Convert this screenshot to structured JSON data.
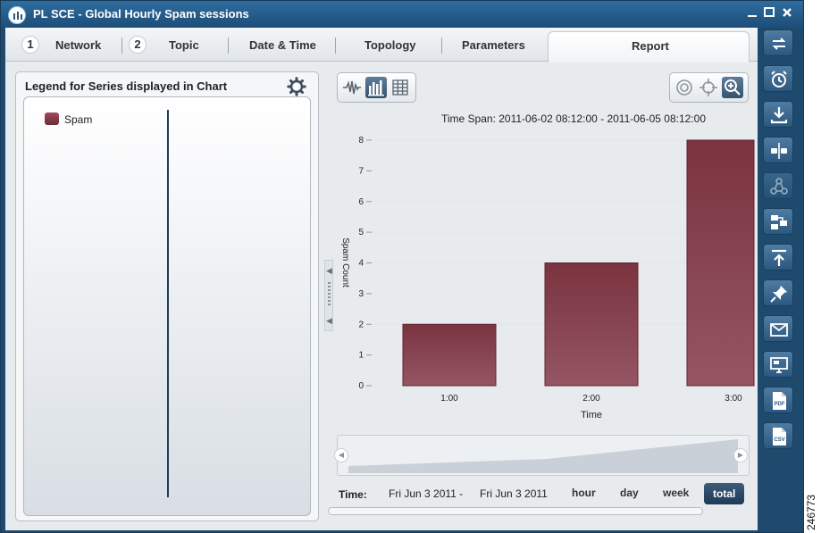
{
  "window": {
    "title": "PL SCE - Global Hourly Spam sessions",
    "controls": [
      "minimize",
      "maximize",
      "close"
    ]
  },
  "tabs": [
    {
      "num": "1",
      "label": "Network"
    },
    {
      "num": "2",
      "label": "Topic"
    },
    {
      "num": "",
      "label": "Date & Time"
    },
    {
      "num": "",
      "label": "Topology"
    },
    {
      "num": "",
      "label": "Parameters"
    },
    {
      "num": "",
      "label": "Report",
      "active": true
    }
  ],
  "legend": {
    "title": "Legend for Series displayed in Chart",
    "items": [
      {
        "name": "Spam",
        "color": "#7a3440"
      }
    ]
  },
  "chart_toolbar": {
    "view_buttons": [
      "waveform-icon",
      "bar-chart-icon",
      "table-grid-icon"
    ],
    "selected_view": "bar-chart-icon",
    "zoom_buttons": [
      "target-icon",
      "crosshair-icon",
      "zoom-in-icon"
    ],
    "selected_zoom": "zoom-in-icon"
  },
  "chart_data": {
    "type": "bar",
    "title": "Time Span: 2011-06-02 08:12:00 - 2011-06-05 08:12:00",
    "categories": [
      "1:00",
      "2:00",
      "3:00"
    ],
    "series": [
      {
        "name": "Spam",
        "values": [
          2,
          4,
          8
        ],
        "color": "#7a3440"
      }
    ],
    "xlabel": "Time",
    "ylabel": "Spam Count",
    "ylim": [
      0,
      8
    ],
    "yticks": [
      "0",
      "1",
      "2",
      "3",
      "4",
      "5",
      "6",
      "7",
      "8"
    ],
    "grid": true,
    "legend_placement": "left-panel"
  },
  "time_range": {
    "label": "Time:",
    "from": "Fri Jun 3 2011  -",
    "to": "Fri Jun 3 2011",
    "buttons": [
      "hour",
      "day",
      "week",
      "total"
    ],
    "active": "total"
  },
  "right_toolbar": [
    "refresh-icon",
    "alarm-clock-icon",
    "download-icon",
    "split-icon",
    "network-nodes-icon",
    "layout-blocks-icon",
    "upload-icon",
    "pin-icon",
    "mail-icon",
    "monitor-icon",
    "pdf-icon",
    "csv-icon"
  ],
  "side_code": "246773",
  "colors": {
    "window": "#1f4a6e",
    "bar": "#7a3440",
    "accent": "#2c577e"
  }
}
